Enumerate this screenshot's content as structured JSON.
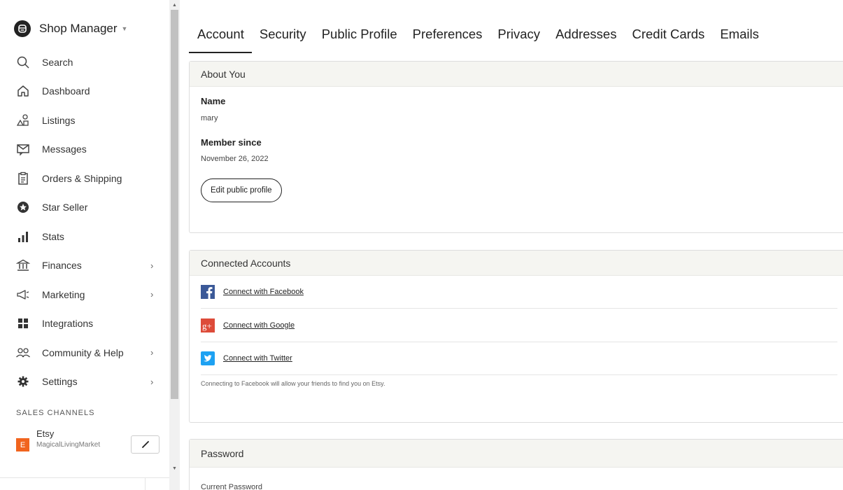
{
  "brand": {
    "title": "Shop Manager"
  },
  "nav": [
    {
      "label": "Search",
      "icon": "search-icon",
      "chevron": false
    },
    {
      "label": "Dashboard",
      "icon": "home-icon",
      "chevron": false
    },
    {
      "label": "Listings",
      "icon": "listings-icon",
      "chevron": false
    },
    {
      "label": "Messages",
      "icon": "messages-icon",
      "chevron": false
    },
    {
      "label": "Orders & Shipping",
      "icon": "clipboard-icon",
      "chevron": false
    },
    {
      "label": "Star Seller",
      "icon": "star-seller-icon",
      "chevron": false
    },
    {
      "label": "Stats",
      "icon": "stats-icon",
      "chevron": false
    },
    {
      "label": "Finances",
      "icon": "bank-icon",
      "chevron": true
    },
    {
      "label": "Marketing",
      "icon": "megaphone-icon",
      "chevron": true
    },
    {
      "label": "Integrations",
      "icon": "grid-icon",
      "chevron": false
    },
    {
      "label": "Community & Help",
      "icon": "community-icon",
      "chevron": true
    },
    {
      "label": "Settings",
      "icon": "gear-icon",
      "chevron": true
    }
  ],
  "sales_channels": {
    "title": "SALES CHANNELS",
    "badge": "E",
    "name": "Etsy",
    "shop": "MagicalLivingMarket"
  },
  "tabs": [
    {
      "label": "Account",
      "active": true
    },
    {
      "label": "Security",
      "active": false
    },
    {
      "label": "Public Profile",
      "active": false
    },
    {
      "label": "Preferences",
      "active": false
    },
    {
      "label": "Privacy",
      "active": false
    },
    {
      "label": "Addresses",
      "active": false
    },
    {
      "label": "Credit Cards",
      "active": false
    },
    {
      "label": "Emails",
      "active": false
    }
  ],
  "about": {
    "title": "About You",
    "name_label": "Name",
    "name_value": "mary",
    "member_label": "Member since",
    "member_value": "November 26, 2022",
    "edit_button": "Edit public profile"
  },
  "connected": {
    "title": "Connected Accounts",
    "facebook": "Connect with Facebook",
    "google": "Connect with Google",
    "twitter": "Connect with Twitter",
    "note": "Connecting to Facebook will allow your friends to find you on Etsy."
  },
  "password": {
    "title": "Password",
    "current_label": "Current Password"
  },
  "colors": {
    "etsy_orange": "#f1641e",
    "facebook": "#3b5998",
    "google": "#dd4b39",
    "twitter": "#1da1f2",
    "panel_header": "#f5f5f1"
  }
}
